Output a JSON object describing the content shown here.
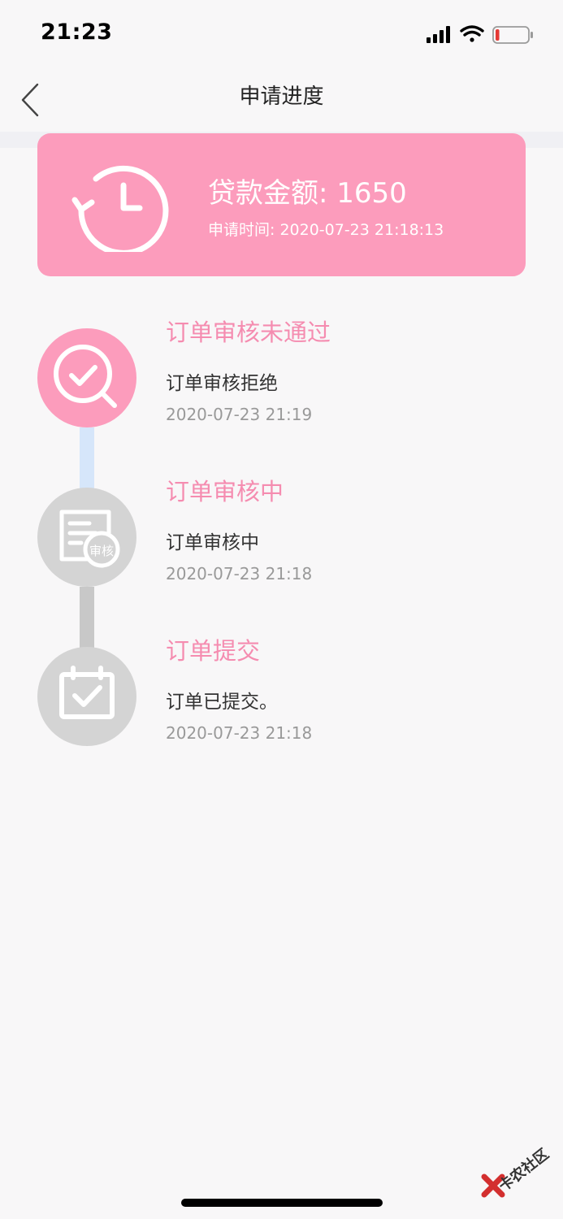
{
  "status_bar": {
    "time": "21:23",
    "icons": [
      "signal-icon",
      "wifi-icon",
      "battery-icon"
    ],
    "battery_level": 0.12
  },
  "nav": {
    "title": "申请进度",
    "back_icon": "chevron-left-icon"
  },
  "loan_card": {
    "amount_text": "贷款金额: 1650",
    "apply_time_text": "申请时间: 2020-07-23 21:18:13",
    "icon": "history-clock-icon",
    "color": "#fc9cbc"
  },
  "steps": [
    {
      "title": "订单审核未通过",
      "desc": "订单审核拒绝",
      "time": "2020-07-23 21:19",
      "icon": "review-check-icon",
      "state": "active"
    },
    {
      "title": "订单审核中",
      "desc": "订单审核中",
      "time": "2020-07-23 21:18",
      "icon": "document-review-icon",
      "badge": "审核",
      "state": "done"
    },
    {
      "title": "订单提交",
      "desc": "订单已提交。",
      "time": "2020-07-23 21:18",
      "icon": "calendar-check-icon",
      "state": "done"
    }
  ],
  "colors": {
    "accent": "#f58cb0",
    "active_circle": "#fc9cbc",
    "inactive_circle": "#d4d4d4",
    "active_connector": "#d6e6fa",
    "inactive_connector": "#c8c8c8"
  },
  "watermark": {
    "text": "卡农社区"
  }
}
